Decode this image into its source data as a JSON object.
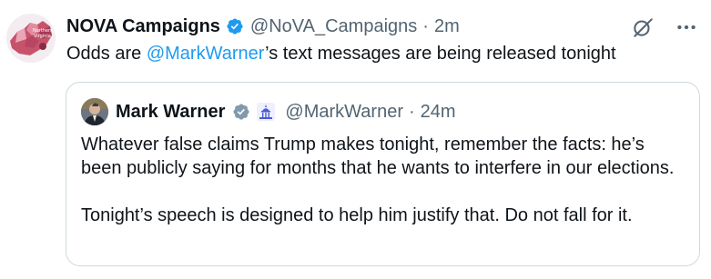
{
  "tweet": {
    "author": {
      "name": "NOVA Campaigns",
      "handle": "@NoVA_Campaigns",
      "verified": true,
      "avatar_text": "Northern Virginia"
    },
    "time": "2m",
    "separator": "·",
    "text": {
      "prefix": "Odds are ",
      "mention": "@MarkWarner",
      "suffix": "’s text messages are being released tonight"
    },
    "actions": {
      "grok_icon": "grok-icon",
      "more_icon": "more-options-icon"
    }
  },
  "quote": {
    "author": {
      "name": "Mark Warner",
      "handle": "@MarkWarner",
      "verified": true,
      "affiliate_icon": "capitol-icon"
    },
    "time": "24m",
    "separator": "·",
    "paragraphs": [
      "Whatever false claims Trump makes tonight, remember the facts: he’s been publicly saying for months that he wants to interfere in our elections.",
      "Tonight’s speech is designed to help him justify that. Do not fall for it."
    ]
  },
  "colors": {
    "text": "#0f1419",
    "muted": "#536471",
    "link": "#1d9bf0",
    "verified": "#1d9bf0",
    "gray_badge": "#829aab",
    "border": "#cfd9de"
  }
}
